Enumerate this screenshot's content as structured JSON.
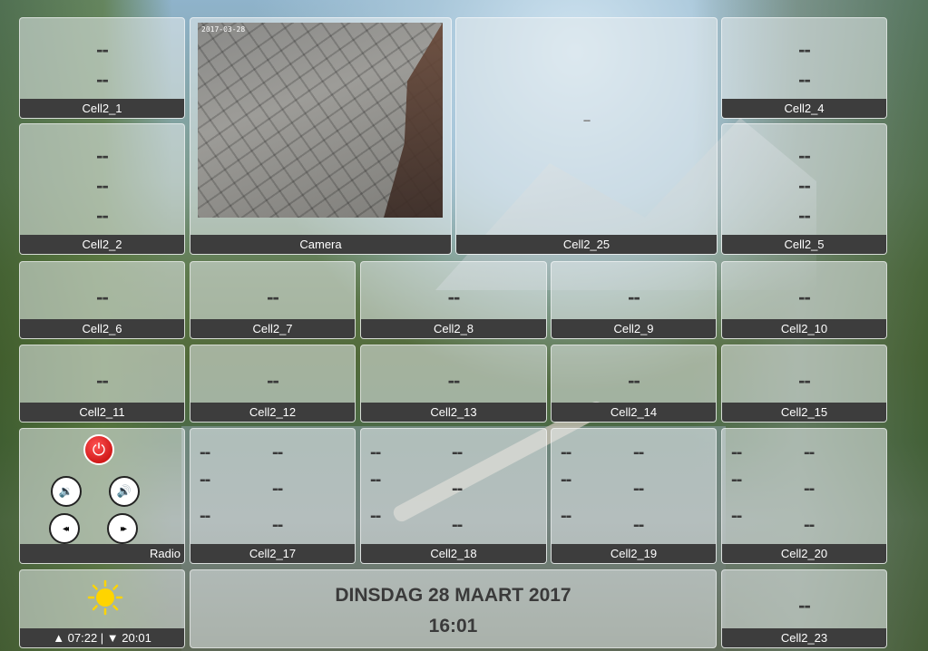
{
  "dash": "--",
  "tiles": {
    "cell2_1": {
      "label": "Cell2_1"
    },
    "camera": {
      "label": "Camera",
      "stamp": "2017-03-28"
    },
    "cell2_25": {
      "label": "Cell2_25"
    },
    "cell2_4": {
      "label": "Cell2_4"
    },
    "cell2_2": {
      "label": "Cell2_2"
    },
    "cell2_5": {
      "label": "Cell2_5"
    },
    "cell2_6": {
      "label": "Cell2_6"
    },
    "cell2_7": {
      "label": "Cell2_7"
    },
    "cell2_8": {
      "label": "Cell2_8"
    },
    "cell2_9": {
      "label": "Cell2_9"
    },
    "cell2_10": {
      "label": "Cell2_10"
    },
    "cell2_11": {
      "label": "Cell2_11"
    },
    "cell2_12": {
      "label": "Cell2_12"
    },
    "cell2_13": {
      "label": "Cell2_13"
    },
    "cell2_14": {
      "label": "Cell2_14"
    },
    "cell2_15": {
      "label": "Cell2_15"
    },
    "radio": {
      "label": "Radio"
    },
    "cell2_17": {
      "label": "Cell2_17"
    },
    "cell2_18": {
      "label": "Cell2_18"
    },
    "cell2_19": {
      "label": "Cell2_19"
    },
    "cell2_20": {
      "label": "Cell2_20"
    },
    "weather": {
      "sunrise_sunset": "▲ 07:22 | ▼ 20:01"
    },
    "clock": {
      "date": "DINSDAG 28 MAART 2017",
      "time": "16:01"
    },
    "cell2_23": {
      "label": "Cell2_23"
    }
  },
  "icons": {
    "power": "⏻",
    "vol_down": "🔉",
    "vol_up": "🔊",
    "prev": "◂◂",
    "next": "▸▸"
  },
  "colors": {
    "label_bar": "#3d3d3d",
    "power": "#e02424",
    "sun": "#ffd400"
  }
}
